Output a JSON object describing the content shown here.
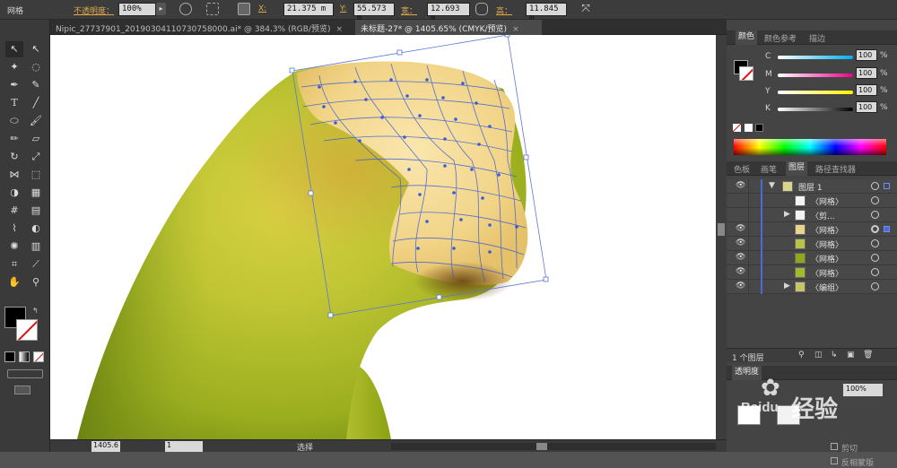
{
  "control_bar": {
    "mode_label": "网格",
    "opacity_label": "不透明度：",
    "opacity_value": "100%",
    "x_label": "X:",
    "x_value": "21.375 m",
    "y_label": "Y:",
    "y_value": "55.573 m",
    "width_label": "宽：",
    "width_value": "12.693 m",
    "height_label": "高：",
    "height_value": "11.845 m"
  },
  "tabs": [
    {
      "label": "Nipic_27737901_20190304110730758000.ai* @ 384.3% (RGB/预览)",
      "active": false
    },
    {
      "label": "未标题-27* @ 1405.65% (CMYK/预览)",
      "active": true
    }
  ],
  "color_panel": {
    "tabs": [
      "颜色",
      "颜色参考",
      "描边"
    ],
    "channels": [
      {
        "name": "C",
        "value": "100"
      },
      {
        "name": "M",
        "value": "100"
      },
      {
        "name": "Y",
        "value": "100"
      },
      {
        "name": "K",
        "value": "100"
      }
    ],
    "unit": "%"
  },
  "layers_panel": {
    "tabs": [
      "色板",
      "画笔",
      "图层",
      "路径查找器"
    ],
    "rows": [
      {
        "name": "图层 1",
        "visible": true
      },
      {
        "name": "〈网格〉",
        "visible": false
      },
      {
        "name": "〈剪...",
        "visible": false
      },
      {
        "name": "〈网格〉",
        "visible": true
      },
      {
        "name": "〈网格〉",
        "visible": true
      },
      {
        "name": "〈网格〉",
        "visible": true
      },
      {
        "name": "〈网格〉",
        "visible": true
      },
      {
        "name": "〈编组〉",
        "visible": true
      }
    ],
    "footer_count": "1 个图层"
  },
  "transparency_panel": {
    "tab_label": "透明度",
    "opacity_value": "100%",
    "options": [
      "剪切",
      "反相蒙版"
    ]
  },
  "status_bar": {
    "zoom": "1405.6",
    "page": "1",
    "tool": "选择"
  },
  "watermark": {
    "text": "经验",
    "brand": "Baidu"
  },
  "colors": {
    "ui_dark": "#3c3c3c",
    "accent_blue": "#4a6cd4",
    "mesh_line": "#3a5bd9",
    "object_green": "#9aae1e",
    "object_cream": "#f4dc9a"
  }
}
